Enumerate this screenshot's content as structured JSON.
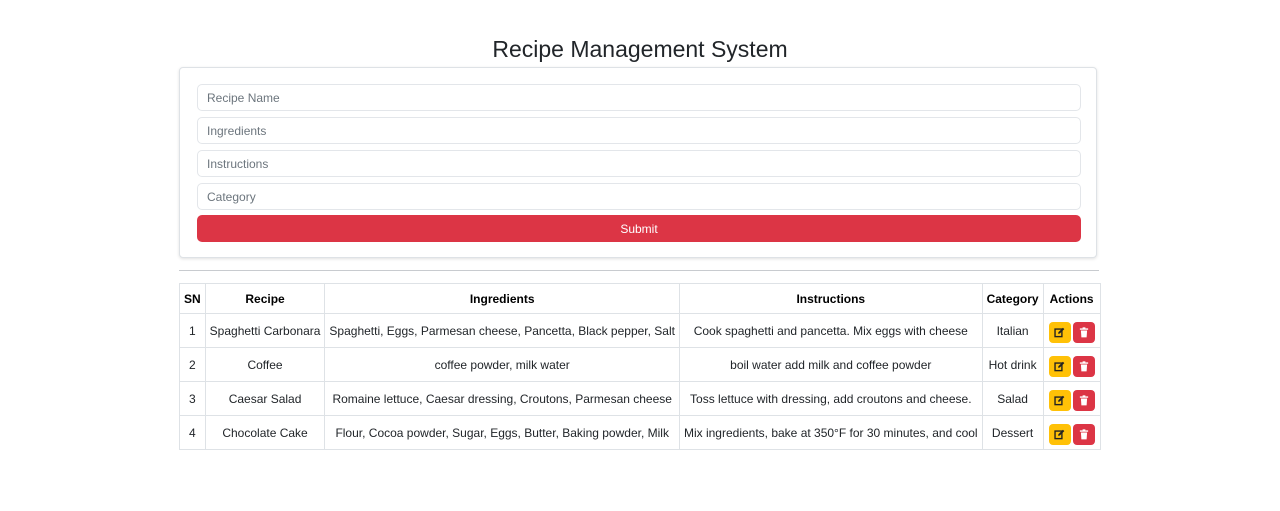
{
  "page": {
    "title": "Recipe Management System"
  },
  "form": {
    "fields": [
      {
        "placeholder": "Recipe Name",
        "value": ""
      },
      {
        "placeholder": "Ingredients",
        "value": ""
      },
      {
        "placeholder": "Instructions",
        "value": ""
      },
      {
        "placeholder": "Category",
        "value": ""
      }
    ],
    "submit_label": "Submit",
    "accent_color": "#dc3545"
  },
  "table": {
    "headers": [
      "SN",
      "Recipe",
      "Ingredients",
      "Instructions",
      "Category",
      "Actions"
    ],
    "rows": [
      {
        "sn": "1",
        "recipe": "Spaghetti Carbonara",
        "ingredients": "Spaghetti, Eggs, Parmesan cheese, Pancetta, Black pepper, Salt",
        "instructions": "Cook spaghetti and pancetta. Mix eggs with cheese",
        "category": "Italian"
      },
      {
        "sn": "2",
        "recipe": "Coffee",
        "ingredients": "coffee powder, milk water",
        "instructions": "boil water add milk and coffee powder",
        "category": "Hot drink"
      },
      {
        "sn": "3",
        "recipe": "Caesar Salad",
        "ingredients": "Romaine lettuce, Caesar dressing, Croutons, Parmesan cheese",
        "instructions": "Toss lettuce with dressing, add croutons and cheese.",
        "category": "Salad"
      },
      {
        "sn": "4",
        "recipe": "Chocolate Cake",
        "ingredients": "Flour, Cocoa powder, Sugar, Eggs, Butter, Baking powder, Milk",
        "instructions": "Mix ingredients, bake at 350°F for 30 minutes, and cool",
        "category": "Dessert"
      }
    ],
    "actions": {
      "edit_icon": "edit-icon",
      "delete_icon": "trash-icon",
      "edit_color": "#ffc107",
      "delete_color": "#dc3545"
    }
  }
}
